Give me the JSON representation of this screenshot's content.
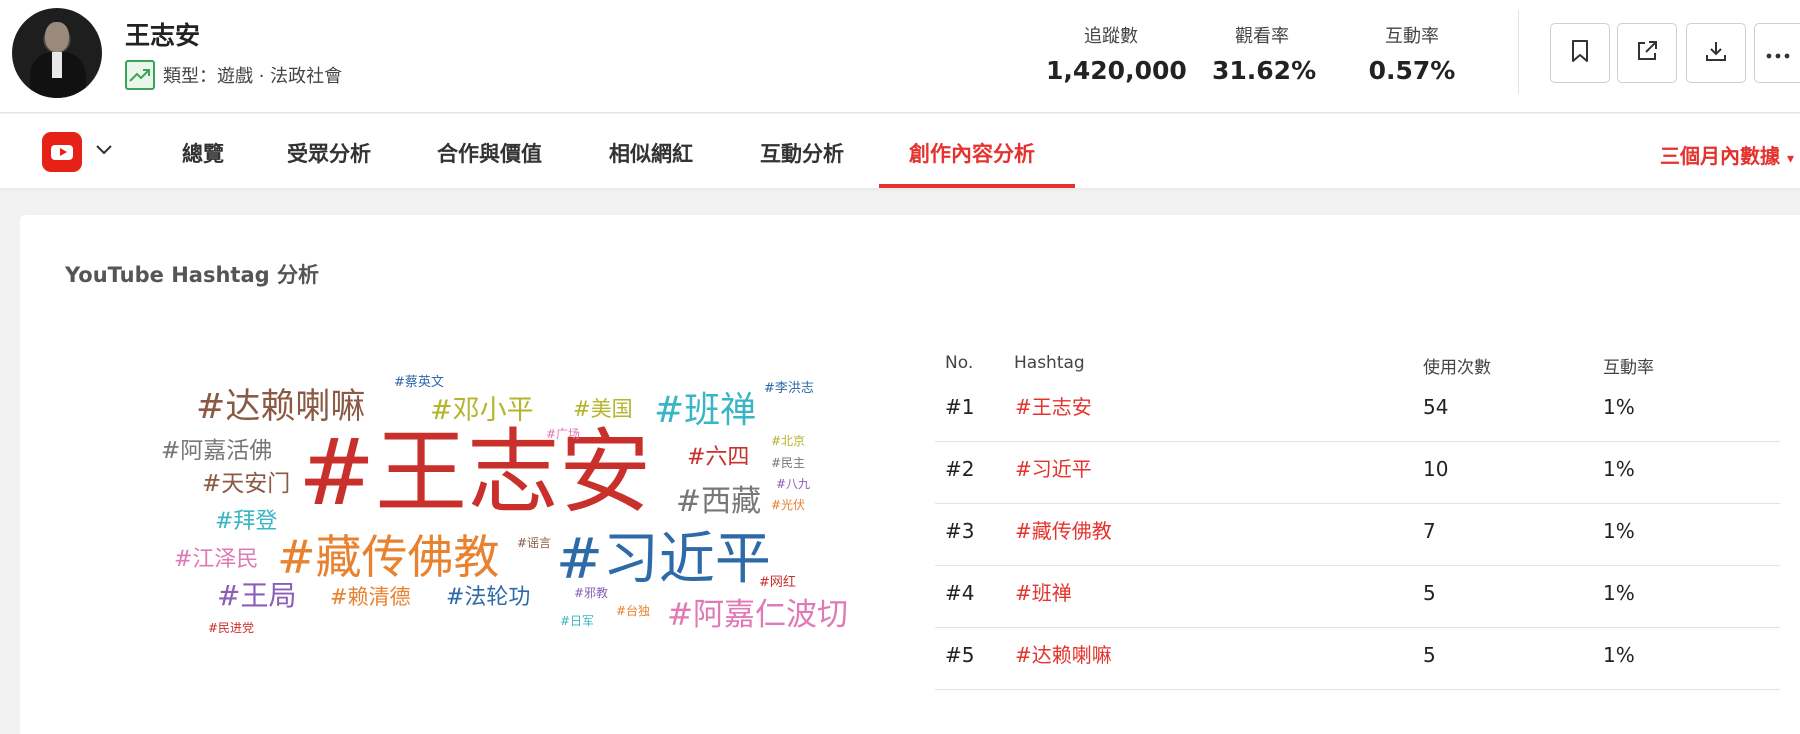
{
  "header": {
    "name": "王志安",
    "type_text": "類型：遊戲 · 法政社會",
    "stats": [
      {
        "label": "追蹤數",
        "value": "1,420,000"
      },
      {
        "label": "觀看率",
        "value": "31.62%"
      },
      {
        "label": "互動率",
        "value": "0.57%"
      }
    ],
    "actions": [
      "bookmark-icon",
      "external-link-icon",
      "download-icon",
      "more-icon"
    ]
  },
  "tabs": {
    "platform_icon": "youtube-icon",
    "items": [
      "總覽",
      "受眾分析",
      "合作與價值",
      "相似網紅",
      "互動分析",
      "創作內容分析"
    ],
    "active_index": 5,
    "period": "三個月內數據"
  },
  "card": {
    "title": "YouTube Hashtag 分析",
    "word_cloud": [
      {
        "text": "#王志安",
        "color": "#c9302c"
      },
      {
        "text": "#习近平",
        "color": "#2e6aa8"
      },
      {
        "text": "#藏传佛教",
        "color": "#e8822f"
      },
      {
        "text": "#达赖喇嘛",
        "color": "#8a5a44"
      },
      {
        "text": "#班禅",
        "color": "#38b6c4"
      },
      {
        "text": "#阿嘉仁波切",
        "color": "#e079b7"
      },
      {
        "text": "#邓小平",
        "color": "#b5b52b"
      },
      {
        "text": "#西藏",
        "color": "#777777"
      },
      {
        "text": "#阿嘉活佛",
        "color": "#777777"
      },
      {
        "text": "#天安门",
        "color": "#8a5a44"
      },
      {
        "text": "#六四",
        "color": "#c9302c"
      },
      {
        "text": "#美国",
        "color": "#b5b52b"
      },
      {
        "text": "#拜登",
        "color": "#38b6c4"
      },
      {
        "text": "#江泽民",
        "color": "#e079b7"
      },
      {
        "text": "#王局",
        "color": "#8b5fb8"
      },
      {
        "text": "#赖清德",
        "color": "#e8822f"
      },
      {
        "text": "#法轮功",
        "color": "#2e6aa8"
      },
      {
        "text": "#蔡英文",
        "color": "#2e6aa8"
      },
      {
        "text": "#李洪志",
        "color": "#2e6aa8"
      },
      {
        "text": "#广场",
        "color": "#e079b7"
      },
      {
        "text": "#北京",
        "color": "#b5b52b"
      },
      {
        "text": "#民主",
        "color": "#777777"
      },
      {
        "text": "#八九",
        "color": "#8b5fb8"
      },
      {
        "text": "#光伏",
        "color": "#e8822f"
      },
      {
        "text": "#谣言",
        "color": "#8a5a44"
      },
      {
        "text": "#网红",
        "color": "#c9302c"
      },
      {
        "text": "#邪教",
        "color": "#8b5fb8"
      },
      {
        "text": "#台独",
        "color": "#e8822f"
      },
      {
        "text": "#日军",
        "color": "#38b6c4"
      },
      {
        "text": "#民进党",
        "color": "#c9302c"
      }
    ],
    "table": {
      "headers": [
        "No.",
        "Hashtag",
        "使用次數",
        "互動率"
      ],
      "rows": [
        {
          "no": "#1",
          "tag": "#王志安",
          "count": "54",
          "rate": "1%"
        },
        {
          "no": "#2",
          "tag": "#习近平",
          "count": "10",
          "rate": "1%"
        },
        {
          "no": "#3",
          "tag": "#藏传佛教",
          "count": "7",
          "rate": "1%"
        },
        {
          "no": "#4",
          "tag": "#班禅",
          "count": "5",
          "rate": "1%"
        },
        {
          "no": "#5",
          "tag": "#达赖喇嘛",
          "count": "5",
          "rate": "1%"
        }
      ]
    }
  }
}
